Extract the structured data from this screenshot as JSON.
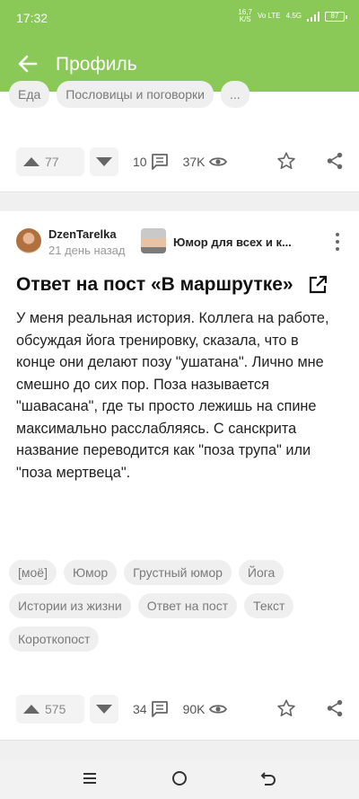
{
  "status_bar": {
    "time": "17:32",
    "speed_value": "16,7",
    "speed_unit": "K/S",
    "carrier": "Vo LTE",
    "network": "4.5G",
    "battery": "87"
  },
  "app_bar": {
    "title": "Профиль",
    "back_icon": "arrow-left-icon"
  },
  "previous_post": {
    "tags": [
      "Еда",
      "Пословицы и поговорки",
      "..."
    ],
    "upvotes": "77",
    "comments": "10",
    "views": "37K"
  },
  "post": {
    "author": "DzenTarelka",
    "time": "21 день назад",
    "community": "Юмор для всех и к...",
    "title": "Ответ на пост «В маршрутке»",
    "text": "У меня реальная история. Коллега на работе, обсуждая йога тренировку, сказала, что в конце они делают позу \"ушатана\". Лично мне смешно до сих пор. Поза называется \"шавасана\", где ты просто лежишь на спине максимально расслабляясь. С санскрита название переводится как \"поза трупа\" или \"поза мертвеца\".",
    "tags": [
      "[моё]",
      "Юмор",
      "Грустный юмор",
      "Йога",
      "Истории из жизни",
      "Ответ на пост",
      "Текст",
      "Короткопост"
    ],
    "upvotes": "575",
    "comments": "34",
    "views": "90K"
  },
  "colors": {
    "accent": "#8ac858",
    "tag_bg": "#efefef",
    "muted": "#8a8a8a"
  }
}
